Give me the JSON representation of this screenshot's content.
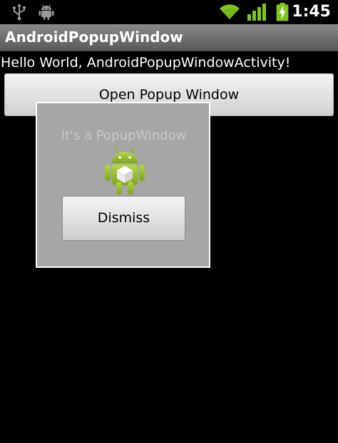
{
  "status_bar": {
    "time": "1:45",
    "icons": [
      "usb-icon",
      "android-debug-icon",
      "wifi-icon",
      "signal-icon",
      "battery-charging-icon"
    ],
    "colors": {
      "accent_green": "#7fc41f",
      "background": "#000000"
    }
  },
  "app": {
    "title": "AndroidPopupWindow"
  },
  "main": {
    "hello_text": "Hello World, AndroidPopupWindowActivity!",
    "open_button_label": "Open Popup Window"
  },
  "popup": {
    "title": "It's a PopupWindow",
    "icon": "android-robot-icon",
    "dismiss_label": "Dismiss"
  },
  "colors": {
    "title_bar": "#707070",
    "popup_background": "#a6a6a6",
    "popup_border": "#ffffff",
    "android_green": "#97c024"
  }
}
